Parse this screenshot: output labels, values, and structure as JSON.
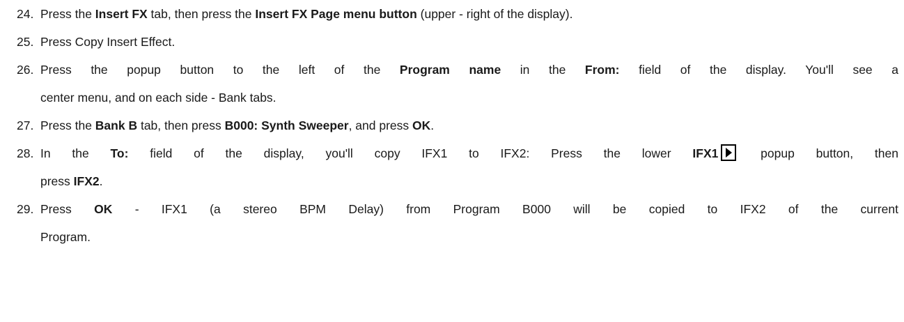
{
  "steps": [
    {
      "num": "24.",
      "parts": {
        "t1": "Press the ",
        "b1": "Insert FX",
        "t2": " tab, then press the ",
        "b2": "Insert FX Page menu button",
        "t3": " (upper - right of the display)."
      }
    },
    {
      "num": "25.",
      "parts": {
        "t1": "Press Copy Insert Effect."
      }
    },
    {
      "num": "26.",
      "parts": {
        "t1": "Press the popup button to the left of the ",
        "b1": "Program name",
        "t2": " in the ",
        "b2": "From:",
        "t3": " field of the display. You'll see a",
        "t4": "center menu, and on each side - Bank tabs."
      }
    },
    {
      "num": "27.",
      "parts": {
        "t1": "Press the ",
        "b1": "Bank B",
        "t2": " tab, then press ",
        "b2": "B000: Synth Sweeper",
        "t3": ", and press ",
        "b3": "OK",
        "t4": "."
      }
    },
    {
      "num": "28.",
      "parts": {
        "t1": "In the ",
        "b1": "To:",
        "t2": " field of the display, you'll copy IFX1 to IFX2: Press the lower ",
        "b2": "IFX1",
        "t3": " popup button, then",
        "t4": "press ",
        "b3": "IFX2",
        "t5": "."
      }
    },
    {
      "num": "29.",
      "parts": {
        "t1": "Press ",
        "b1": "OK",
        "t2": " - IFX1 (a stereo BPM Delay) from Program B000 will be copied to IFX2 of the current",
        "t3": "Program."
      }
    }
  ],
  "icons": {
    "popup": "popup-arrow-icon"
  }
}
